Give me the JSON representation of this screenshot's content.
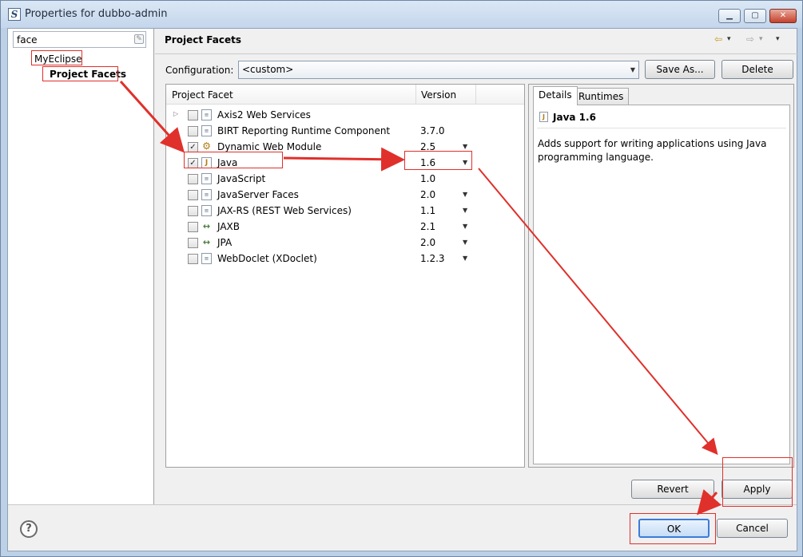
{
  "window": {
    "title": "Properties for dubbo-admin",
    "min_glyph": "▁",
    "max_glyph": "▢",
    "close_glyph": "✕"
  },
  "left": {
    "filter_value": "face",
    "tree": [
      "MyEclipse",
      "Project Facets"
    ]
  },
  "page": {
    "title": "Project Facets",
    "nav": {
      "back": "⇦",
      "back_menu": "▾",
      "forward": "⇨",
      "forward_menu": "▾",
      "view_menu": "▾"
    }
  },
  "configuration": {
    "label": "Configuration:",
    "value": "<custom>",
    "save_as": "Save As...",
    "delete": "Delete"
  },
  "facets": {
    "col_facet": "Project Facet",
    "col_version": "Version",
    "rows": [
      {
        "name": "Axis2 Web Services",
        "version": "",
        "checked": false,
        "expandable": true,
        "icon": "page",
        "dropdown": false
      },
      {
        "name": "BIRT Reporting Runtime Component",
        "version": "3.7.0",
        "checked": false,
        "expandable": false,
        "icon": "page",
        "dropdown": false
      },
      {
        "name": "Dynamic Web Module",
        "version": "2.5",
        "checked": true,
        "expandable": false,
        "icon": "web",
        "dropdown": true
      },
      {
        "name": "Java",
        "version": "1.6",
        "checked": true,
        "expandable": false,
        "icon": "java",
        "dropdown": true
      },
      {
        "name": "JavaScript",
        "version": "1.0",
        "checked": false,
        "expandable": false,
        "icon": "page",
        "dropdown": false
      },
      {
        "name": "JavaServer Faces",
        "version": "2.0",
        "checked": false,
        "expandable": false,
        "icon": "page",
        "dropdown": true
      },
      {
        "name": "JAX-RS (REST Web Services)",
        "version": "1.1",
        "checked": false,
        "expandable": false,
        "icon": "page",
        "dropdown": true
      },
      {
        "name": "JAXB",
        "version": "2.1",
        "checked": false,
        "expandable": false,
        "icon": "arrows",
        "dropdown": true
      },
      {
        "name": "JPA",
        "version": "2.0",
        "checked": false,
        "expandable": false,
        "icon": "arrows",
        "dropdown": true
      },
      {
        "name": "WebDoclet (XDoclet)",
        "version": "1.2.3",
        "checked": false,
        "expandable": false,
        "icon": "page",
        "dropdown": true
      }
    ]
  },
  "details": {
    "tab_details": "Details",
    "tab_runtimes": "Runtimes",
    "title": "Java 1.6",
    "description": "Adds support for writing applications using Java programming language."
  },
  "buttons": {
    "revert": "Revert",
    "apply": "Apply",
    "ok": "OK",
    "cancel": "Cancel",
    "help": "?"
  },
  "colors": {
    "annotation": "#e0302b",
    "ok_border": "#3d7bd9"
  }
}
